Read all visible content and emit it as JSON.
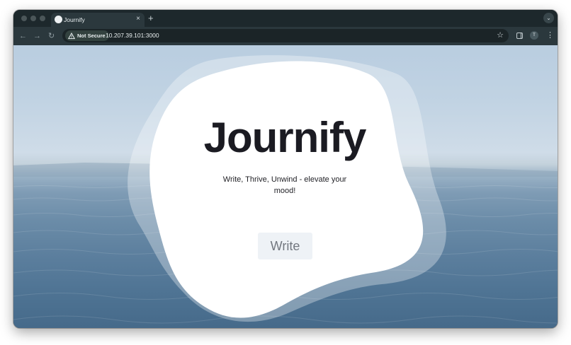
{
  "browser": {
    "tab_title": "Journify",
    "tab_close": "×",
    "new_tab": "+",
    "tab_search_icon": "chevron-down-icon",
    "security_label": "Not Secure",
    "url": "10.207.39.101:3000",
    "profile_initial": "T",
    "back_icon": "←",
    "forward_icon": "→",
    "reload_icon": "↻",
    "star_icon": "☆",
    "menu_icon": "⋮"
  },
  "page": {
    "logo": "Journify",
    "tagline": "Write, Thrive, Unwind - elevate your mood!",
    "write_button": "Write"
  },
  "colors": {
    "blob": "#ffffff",
    "blob_outer": "rgba(255,255,255,0.35)",
    "button_bg": "#eef2f6",
    "logo_text": "#1b1b22"
  }
}
